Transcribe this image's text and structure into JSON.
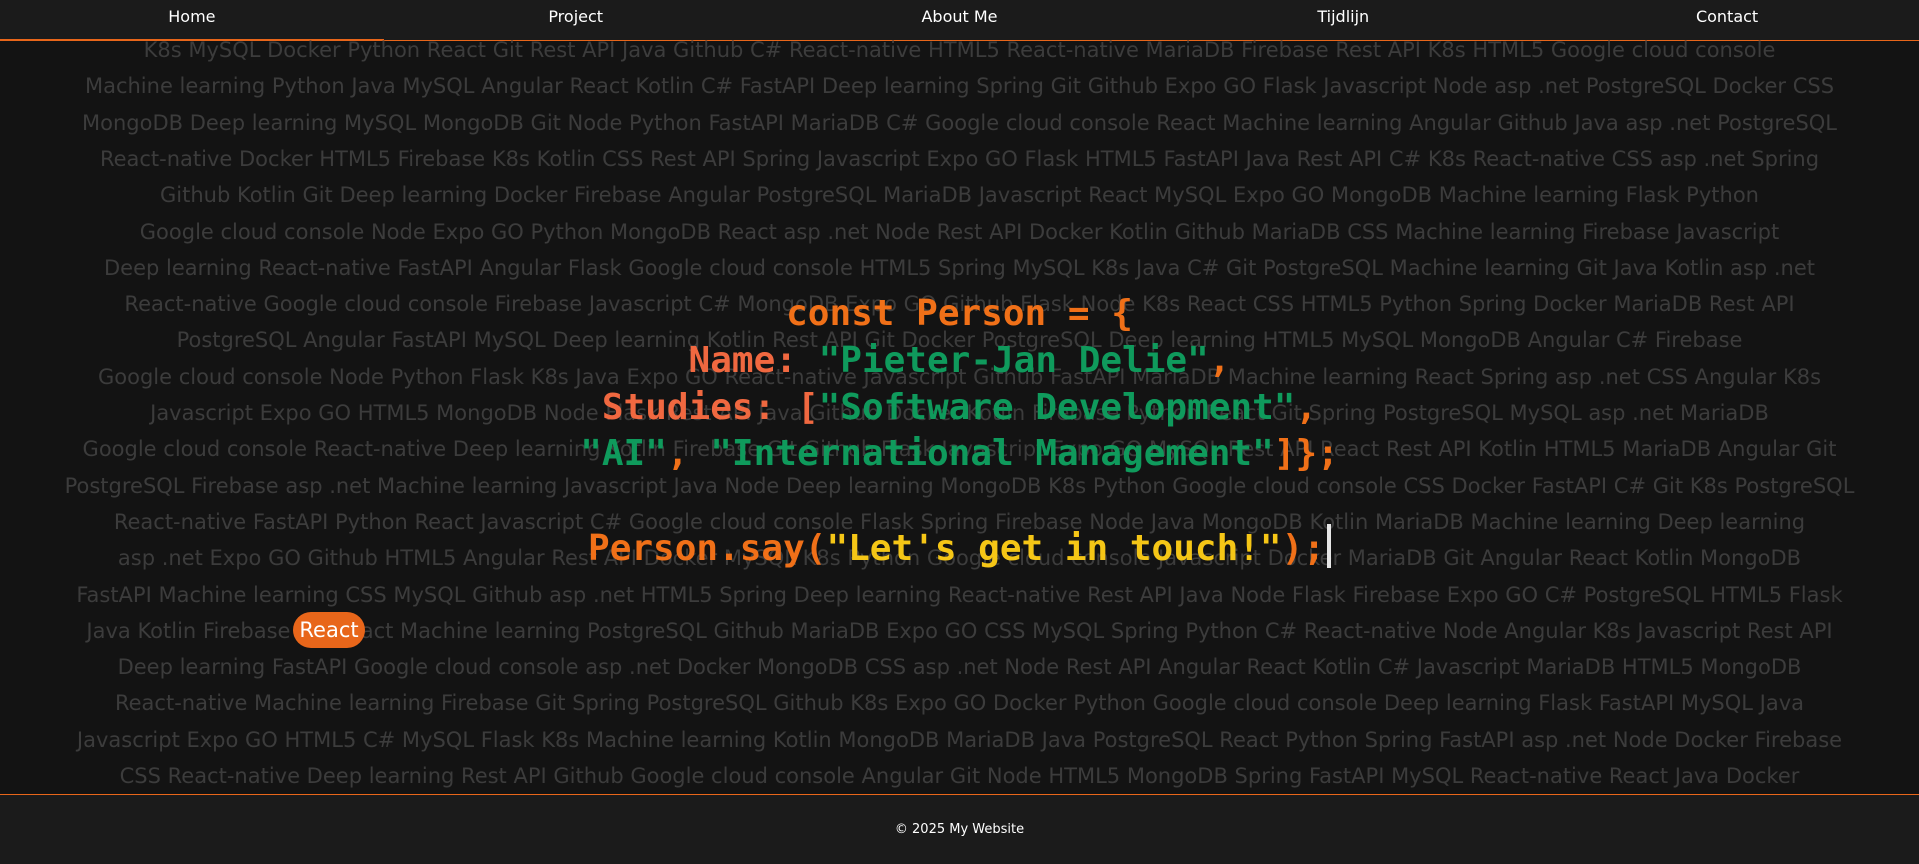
{
  "nav": {
    "items": [
      {
        "label": "Home"
      },
      {
        "label": "Project"
      },
      {
        "label": "About Me"
      },
      {
        "label": "Tijdlijn"
      },
      {
        "label": "Contact"
      }
    ],
    "active": "Home"
  },
  "background_words": {
    "lines": [
      "K8s MySQL Docker Python React Git Rest API Java Github C# React-native HTML5 React-native MariaDB Firebase Rest API K8s HTML5 Google cloud console",
      "Machine learning Python Java MySQL Angular React Kotlin C# FastAPI Deep learning Spring Git Github Expo GO Flask Javascript Node asp .net PostgreSQL Docker CSS",
      "MongoDB Deep learning MySQL MongoDB Git Node Python FastAPI MariaDB C# Google cloud console React Machine learning Angular Github Java asp .net PostgreSQL",
      "React-native Docker HTML5 Firebase K8s Kotlin CSS Rest API Spring Javascript Expo GO Flask HTML5 FastAPI Java Rest API C# K8s React-native CSS asp .net Spring",
      "Github Kotlin Git Deep learning Docker Firebase Angular PostgreSQL MariaDB Javascript React MySQL Expo GO MongoDB Machine learning Flask Python",
      "Google cloud console Node Expo GO Python MongoDB React asp .net Node Rest API Docker Kotlin Github MariaDB CSS Machine learning Firebase Javascript",
      "Deep learning React-native FastAPI Angular Flask Google cloud console HTML5 Spring MySQL K8s Java C# Git PostgreSQL Machine learning Git Java Kotlin asp .net",
      "React-native Google cloud console Firebase Javascript C# MongoDB Expo GO Github Flask Node K8s React CSS HTML5 Python Spring Docker MariaDB Rest API",
      "PostgreSQL Angular FastAPI MySQL Deep learning Kotlin Rest API Git Docker PostgreSQL Deep learning HTML5 MySQL MongoDB Angular C# Firebase",
      "Google cloud console Node Python Flask K8s Java Expo GO React-native Javascript Github FastAPI MariaDB Machine learning React Spring asp .net CSS Angular K8s",
      "Javascript Expo GO HTML5 MongoDB Node Flask Rest API Java Github Docker Kotlin Firebase Python React Git Spring PostgreSQL MySQL asp .net MariaDB",
      "Google cloud console React-native Deep learning Kotlin Firebase Git Github Flask Javascript Expo GO MySQL Rest API React Rest API Kotlin HTML5 MariaDB Angular Git",
      "PostgreSQL Firebase asp .net Machine learning Javascript Java Node Deep learning MongoDB K8s Python Google cloud console CSS Docker FastAPI C# Git K8s PostgreSQL",
      "React-native FastAPI Python React Javascript C# Google cloud console Flask Spring Firebase Node Java MongoDB Kotlin MariaDB Machine learning Deep learning",
      "asp .net Expo GO Github HTML5 Angular Rest API Docker MySQL K8s Python Google cloud console Javascript Docker MariaDB Git Angular React Kotlin MongoDB",
      "FastAPI Machine learning CSS MySQL Github asp .net HTML5 Spring Deep learning React-native Rest API Java Node Flask Firebase Expo GO C# PostgreSQL HTML5 Flask",
      "Java Kotlin Firebase Git React Machine learning PostgreSQL Github MariaDB Expo GO CSS MySQL Spring Python C# React-native Node Angular K8s Javascript Rest API",
      "Deep learning FastAPI Google cloud console asp .net Docker MongoDB CSS asp .net Node Rest API Angular React Kotlin C# Javascript MariaDB HTML5 MongoDB",
      "React-native Machine learning Firebase Git Spring PostgreSQL Github K8s Expo GO Docker Python Google cloud console Deep learning Flask FastAPI MySQL Java",
      "Javascript Expo GO HTML5 C# MySQL Flask K8s Machine learning Kotlin MongoDB MariaDB Java PostgreSQL React Python Spring FastAPI asp .net Node Docker Firebase",
      "CSS React-native Deep learning Rest API Github Google cloud console Angular Git Node HTML5 MongoDB Spring FastAPI MySQL React-native React Java Docker"
    ],
    "highlighted_tag": "React",
    "highlight_color": "#e8661a"
  },
  "code": {
    "line1": "const Person = {",
    "line2_key": "Name:",
    "line2_value": "\"Pieter-Jan Delie\"",
    "line2_comma": ",",
    "line3_key": "Studies:",
    "line3_bracket": "[",
    "line3_value": "\"Software Development\"",
    "line3_comma": ",",
    "line4_v1": "\"AI\"",
    "line4_sep": ", ",
    "line4_v2": "\"International Management\"",
    "line4_end": "]};",
    "line5_call": "Person.say(",
    "line5_arg": "\"Let's get in touch!\"",
    "line5_end": ");"
  },
  "colors": {
    "accent": "#e8661a",
    "keyword": "#f07018",
    "key": "#f06840",
    "string": "#0f9a5c",
    "call_string": "#f5c616"
  },
  "footer": {
    "copyright": "© 2025 My Website"
  }
}
